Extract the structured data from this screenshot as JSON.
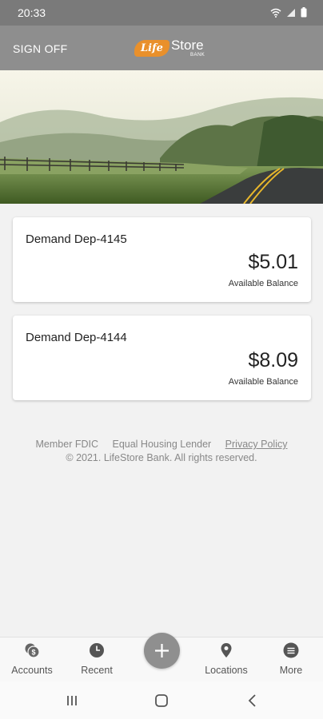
{
  "status_bar": {
    "time": "20:33"
  },
  "header": {
    "sign_off_label": "SIGN OFF",
    "logo_life": "Life",
    "logo_store": "Store",
    "logo_bank": "BANK"
  },
  "accounts": [
    {
      "name": "Demand Dep-4145",
      "balance": "$5.01",
      "balance_caption": "Available Balance"
    },
    {
      "name": "Demand Dep-4144",
      "balance": "$8.09",
      "balance_caption": "Available Balance"
    }
  ],
  "footer": {
    "member_fdic": "Member FDIC",
    "equal_housing": "Equal Housing Lender",
    "privacy_policy": "Privacy Policy",
    "copyright": "© 2021. LifeStore Bank. All rights reserved."
  },
  "bottom_nav": {
    "items": [
      {
        "label": "Accounts",
        "icon": "accounts-coin-icon"
      },
      {
        "label": "Recent",
        "icon": "clock-icon"
      },
      {
        "label": "Locations",
        "icon": "location-pin-icon"
      },
      {
        "label": "More",
        "icon": "menu-icon"
      }
    ],
    "fab_icon": "plus-icon"
  },
  "colors": {
    "header_bg": "#8e8e8e",
    "status_bg": "#7a7a7a",
    "logo_orange": "#e9902b",
    "fab_bg": "#8f8f8f"
  }
}
